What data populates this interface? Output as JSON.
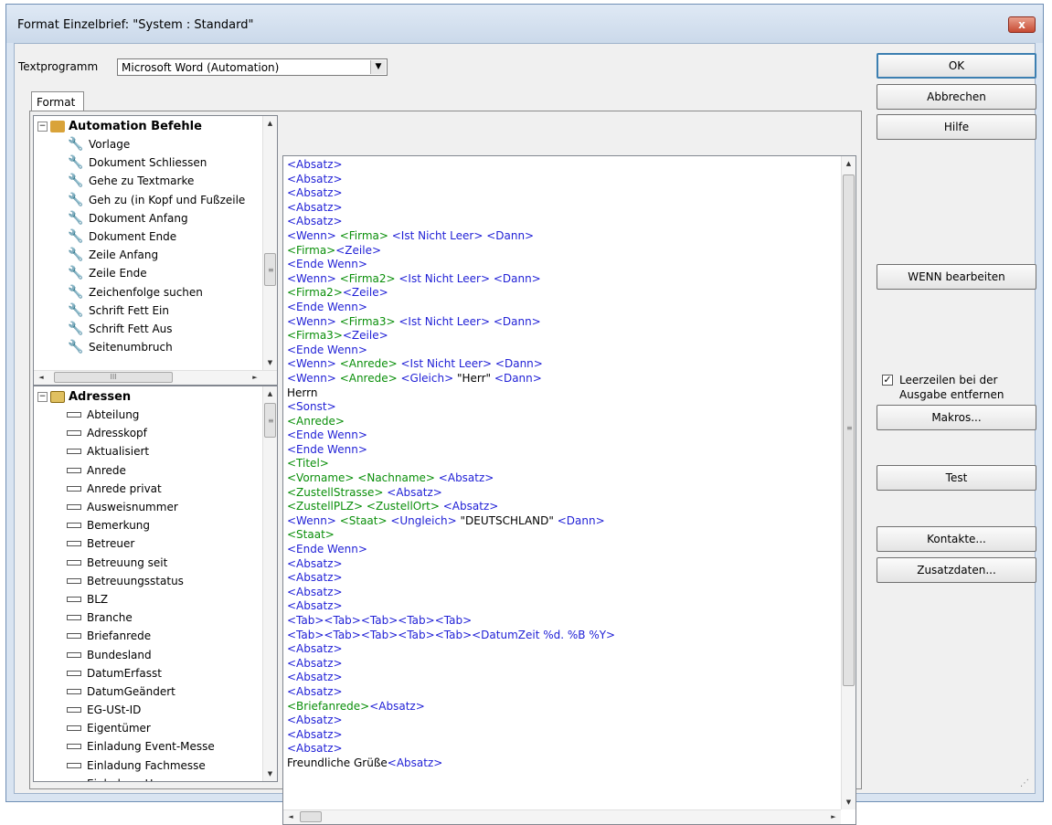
{
  "window": {
    "title": "Format Einzelbrief: \"System : Standard\"",
    "close_glyph": "x"
  },
  "textprogramm": {
    "label": "Textprogramm",
    "value": "Microsoft Word (Automation)"
  },
  "tab": {
    "label": "Format"
  },
  "tree_commands": {
    "header": "Automation Befehle",
    "items": [
      "Vorlage",
      "Dokument Schliessen",
      "Gehe zu Textmarke",
      "Geh zu (in Kopf und Fußzeile",
      "Dokument Anfang",
      "Dokument Ende",
      "Zeile Anfang",
      "Zeile Ende",
      "Zeichenfolge suchen",
      "Schrift Fett Ein",
      "Schrift Fett Aus",
      "Seitenumbruch"
    ]
  },
  "tree_fields": {
    "header": "Adressen",
    "items": [
      "Abteilung",
      "Adresskopf",
      "Aktualisiert",
      "Anrede",
      "Anrede privat",
      "Ausweisnummer",
      "Bemerkung",
      "Betreuer",
      "Betreuung seit",
      "Betreuungsstatus",
      "BLZ",
      "Branche",
      "Briefanrede",
      "Bundesland",
      "DatumErfasst",
      "DatumGeändert",
      "EG-USt-ID",
      "Eigentümer",
      "Einladung Event-Messe",
      "Einladung Fachmesse",
      "Einladung Hausmesse"
    ]
  },
  "editor": {
    "colors": {
      "blue": "#1f1fd6",
      "green": "#0a8f0a",
      "black": "#000000"
    },
    "lines": [
      [
        {
          "t": "<Absatz>",
          "c": "blue"
        }
      ],
      [
        {
          "t": "<Absatz>",
          "c": "blue"
        }
      ],
      [
        {
          "t": "<Absatz>",
          "c": "blue"
        }
      ],
      [
        {
          "t": "<Absatz>",
          "c": "blue"
        }
      ],
      [
        {
          "t": "<Absatz>",
          "c": "blue"
        }
      ],
      [
        {
          "t": "<Wenn> ",
          "c": "blue"
        },
        {
          "t": "<Firma>",
          "c": "green"
        },
        {
          "t": " <Ist Nicht Leer> <Dann>",
          "c": "blue"
        }
      ],
      [
        {
          "t": "<Firma>",
          "c": "green"
        },
        {
          "t": "<Zeile>",
          "c": "blue"
        }
      ],
      [
        {
          "t": "<Ende Wenn>",
          "c": "blue"
        }
      ],
      [
        {
          "t": "<Wenn> ",
          "c": "blue"
        },
        {
          "t": "<Firma2>",
          "c": "green"
        },
        {
          "t": " <Ist Nicht Leer> <Dann>",
          "c": "blue"
        }
      ],
      [
        {
          "t": "<Firma2>",
          "c": "green"
        },
        {
          "t": "<Zeile>",
          "c": "blue"
        }
      ],
      [
        {
          "t": "<Ende Wenn>",
          "c": "blue"
        }
      ],
      [
        {
          "t": "<Wenn> ",
          "c": "blue"
        },
        {
          "t": "<Firma3>",
          "c": "green"
        },
        {
          "t": " <Ist Nicht Leer> <Dann>",
          "c": "blue"
        }
      ],
      [
        {
          "t": "<Firma3>",
          "c": "green"
        },
        {
          "t": "<Zeile>",
          "c": "blue"
        }
      ],
      [
        {
          "t": "<Ende Wenn>",
          "c": "blue"
        }
      ],
      [
        {
          "t": "<Wenn> ",
          "c": "blue"
        },
        {
          "t": "<Anrede>",
          "c": "green"
        },
        {
          "t": " <Ist Nicht Leer> <Dann>",
          "c": "blue"
        }
      ],
      [
        {
          "t": "<Wenn> ",
          "c": "blue"
        },
        {
          "t": "<Anrede>",
          "c": "green"
        },
        {
          "t": " <Gleich> ",
          "c": "blue"
        },
        {
          "t": "\"Herr\"",
          "c": "black"
        },
        {
          "t": " <Dann>",
          "c": "blue"
        }
      ],
      [
        {
          "t": "Herrn",
          "c": "black"
        }
      ],
      [
        {
          "t": "<Sonst>",
          "c": "blue"
        }
      ],
      [
        {
          "t": "<Anrede>",
          "c": "green"
        }
      ],
      [
        {
          "t": "<Ende Wenn>",
          "c": "blue"
        }
      ],
      [
        {
          "t": "<Ende Wenn>",
          "c": "blue"
        }
      ],
      [
        {
          "t": "<Titel>",
          "c": "green"
        }
      ],
      [
        {
          "t": "<Vorname> <Nachname>",
          "c": "green"
        },
        {
          "t": " <Absatz>",
          "c": "blue"
        }
      ],
      [
        {
          "t": "<ZustellStrasse>",
          "c": "green"
        },
        {
          "t": " <Absatz>",
          "c": "blue"
        }
      ],
      [
        {
          "t": "<ZustellPLZ> <ZustellOrt>",
          "c": "green"
        },
        {
          "t": " <Absatz>",
          "c": "blue"
        }
      ],
      [
        {
          "t": "<Wenn> ",
          "c": "blue"
        },
        {
          "t": "<Staat>",
          "c": "green"
        },
        {
          "t": " <Ungleich> ",
          "c": "blue"
        },
        {
          "t": "\"DEUTSCHLAND\"",
          "c": "black"
        },
        {
          "t": " <Dann>",
          "c": "blue"
        }
      ],
      [
        {
          "t": "<Staat>",
          "c": "green"
        }
      ],
      [
        {
          "t": "<Ende Wenn>",
          "c": "blue"
        }
      ],
      [
        {
          "t": "<Absatz>",
          "c": "blue"
        }
      ],
      [
        {
          "t": "<Absatz>",
          "c": "blue"
        }
      ],
      [
        {
          "t": "<Absatz>",
          "c": "blue"
        }
      ],
      [
        {
          "t": "<Absatz>",
          "c": "blue"
        }
      ],
      [
        {
          "t": "<Tab><Tab><Tab><Tab><Tab>",
          "c": "blue"
        }
      ],
      [
        {
          "t": "<Tab><Tab><Tab><Tab><Tab><DatumZeit %d. %B %Y>",
          "c": "blue"
        }
      ],
      [
        {
          "t": "<Absatz>",
          "c": "blue"
        }
      ],
      [
        {
          "t": "<Absatz>",
          "c": "blue"
        }
      ],
      [
        {
          "t": "<Absatz>",
          "c": "blue"
        }
      ],
      [
        {
          "t": "<Absatz>",
          "c": "blue"
        }
      ],
      [
        {
          "t": "<Briefanrede>",
          "c": "green"
        },
        {
          "t": "<Absatz>",
          "c": "blue"
        }
      ],
      [
        {
          "t": "<Absatz>",
          "c": "blue"
        }
      ],
      [
        {
          "t": "<Absatz>",
          "c": "blue"
        }
      ],
      [
        {
          "t": "<Absatz>",
          "c": "blue"
        }
      ],
      [
        {
          "t": "Freundliche Grüße",
          "c": "black"
        },
        {
          "t": "<Absatz>",
          "c": "blue"
        }
      ]
    ]
  },
  "buttons": {
    "ok": "OK",
    "abbrechen": "Abbrechen",
    "hilfe": "Hilfe",
    "wenn": "WENN bearbeiten",
    "makros": "Makros...",
    "test": "Test",
    "kontakte": "Kontakte...",
    "zusatzdaten": "Zusatzdaten..."
  },
  "leerzeilen": {
    "checked": true,
    "line1": "Leerzeilen bei der",
    "line2": "Ausgabe entfernen"
  },
  "scroll_glyphs": {
    "thumb_h": "III",
    "thumb_v": "≡",
    "up": "▲",
    "down": "▼",
    "left": "◄",
    "right": "►"
  }
}
